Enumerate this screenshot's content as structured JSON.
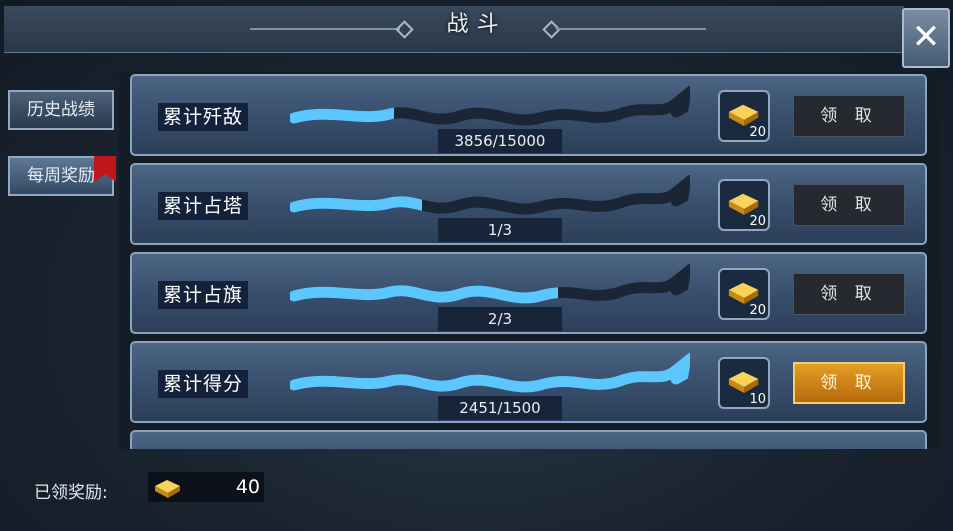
{
  "window": {
    "title": "战斗"
  },
  "close_label": "✕",
  "sidebar": {
    "tabs": [
      {
        "label": "历史战绩",
        "selected": false,
        "flag": false
      },
      {
        "label": "每周奖励",
        "selected": true,
        "flag": true
      }
    ]
  },
  "rewards": [
    {
      "label": "累计歼敌",
      "progress_text": "3856/15000",
      "progress": 0.26,
      "reward_icon": "gold-ingot-icon",
      "reward_count": "20",
      "claim_label": "领 取",
      "claimable": false
    },
    {
      "label": "累计占塔",
      "progress_text": "1/3",
      "progress": 0.33,
      "reward_icon": "gold-ingot-icon",
      "reward_count": "20",
      "claim_label": "领 取",
      "claimable": false
    },
    {
      "label": "累计占旗",
      "progress_text": "2/3",
      "progress": 0.67,
      "reward_icon": "gold-ingot-icon",
      "reward_count": "20",
      "claim_label": "领 取",
      "claimable": false
    },
    {
      "label": "累计得分",
      "progress_text": "2451/1500",
      "progress": 1.0,
      "reward_icon": "gold-ingot-icon",
      "reward_count": "10",
      "claim_label": "领 取",
      "claimable": true
    }
  ],
  "footer": {
    "label": "已领奖励:",
    "gold_icon": "gold-ingot-icon",
    "value": "40"
  },
  "colors": {
    "dragon_lit": "#5cc6ff",
    "dragon_dim": "#1a2636",
    "claim_active": "#e3a023",
    "flag": "#c0161c"
  }
}
